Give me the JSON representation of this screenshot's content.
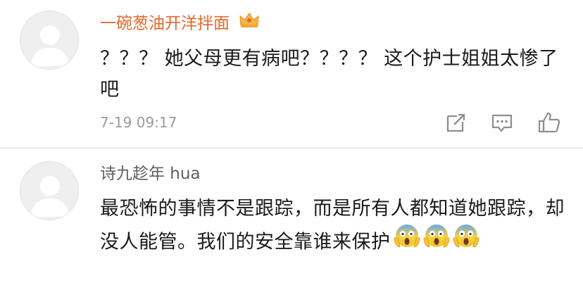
{
  "comments": [
    {
      "username": "一碗葱油开洋拌面",
      "text": "？？？ 她父母更有病吧？？？？ 这个护士姐姐太惨了吧",
      "timestamp": "7-19 09:17",
      "username_color": "#e8662b",
      "badge_icon": "crown-icon",
      "actions": [
        "share-icon",
        "reply-icon",
        "like-icon"
      ]
    },
    {
      "username": "诗九趁年 hua",
      "text": "最恐怖的事情不是跟踪，而是所有人都知道她跟踪，却没人能管。我们的安全靠谁来保护",
      "emojis": [
        "scream-emoji",
        "scream-emoji",
        "scream-emoji"
      ],
      "username_color": "#606060"
    }
  ]
}
